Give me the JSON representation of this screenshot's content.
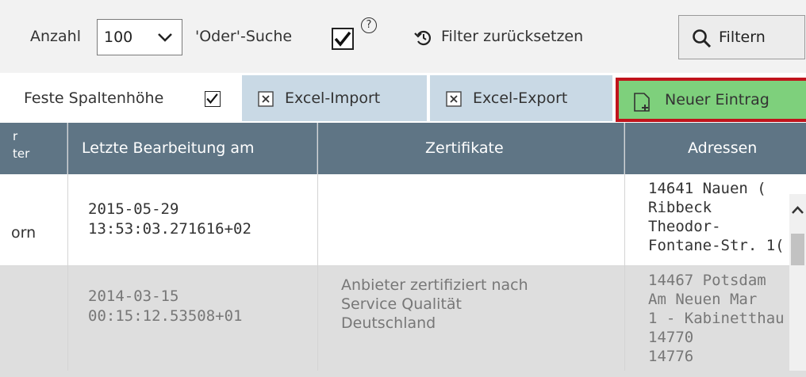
{
  "filters": {
    "count_label": "Anzahl",
    "count_value": "100",
    "or_search_label": "'Oder'-Suche",
    "help_glyph": "?",
    "reset_label": "Filter zurücksetzen",
    "filter_button": "Filtern"
  },
  "toolbar": {
    "fixed_height_label": "Feste Spaltenhöhe",
    "excel_import": "Excel-Import",
    "excel_export": "Excel-Export",
    "new_entry": "Neuer Eintrag"
  },
  "table": {
    "columns": [
      "r\nter",
      "Letzte Bearbeitung am",
      "Zertifikate",
      "Adressen"
    ],
    "rows": [
      {
        "partial": "orn",
        "last_edit": [
          "2015-05-29",
          "13:53:03.271616+02"
        ],
        "certificates": [],
        "addresses": [
          "14641 Nauen (",
          "Ribbeck",
          "Theodor-",
          "Fontane-Str. 1("
        ]
      },
      {
        "partial": "",
        "last_edit": [
          "2014-03-15",
          "00:15:12.53508+01"
        ],
        "certificates": [
          "Anbieter zertifiziert nach",
          "Service Qualität",
          "Deutschland"
        ],
        "addresses": [
          "14467 Potsdam",
          "Am Neuen Mar",
          "1 - Kabinetthau",
          "14770",
          "14776"
        ]
      }
    ]
  },
  "colors": {
    "header_bg": "#5f7585",
    "toolbar_blue": "#c9d9e5",
    "new_entry_green": "#7ed07c",
    "highlight_red": "#c0141c"
  }
}
